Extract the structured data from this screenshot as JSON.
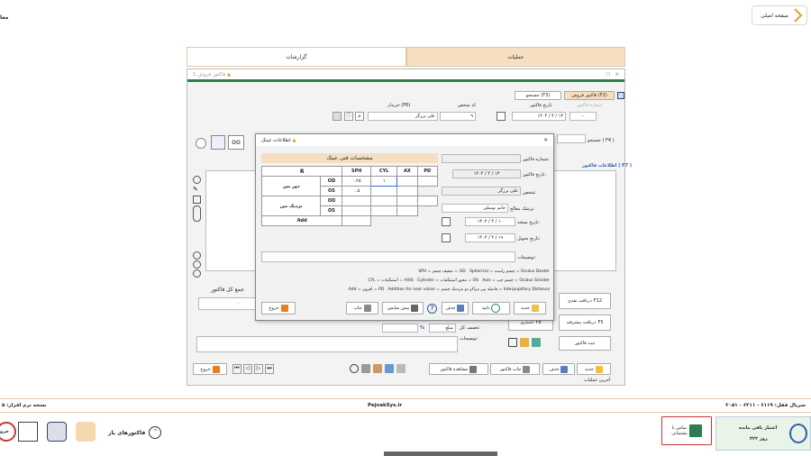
{
  "corner_text": "معا",
  "home_label": "صفحه اصلی",
  "tabs": {
    "reports": "گزارشات",
    "operations": "عملیات"
  },
  "window": {
    "title": "فاکتور فروش 1"
  },
  "subtabs": {
    "search": "جستجو (F3)",
    "factor": "فاکتور فروش (F2)"
  },
  "header": {
    "factor_no_lbl": "شماره فاکتور",
    "factor_date_lbl": "تاریخ فاکتور",
    "customer_code_lbl": "کد شخص",
    "buyer_lbl": "خریدار (F6)",
    "factor_no": "-",
    "factor_date": "۱۴۰۴ / ۴ / ۱۳",
    "customer_code": "۹",
    "buyer": "علی برزگر",
    "search_lbl": "جستجو ( F4 )",
    "info_lbl": "اطلاعات فاکتور ( F7 )",
    "hash": "#"
  },
  "dialog": {
    "title": "اطلاعات عینک",
    "section": "مشخصات فنی عینک",
    "cols": [
      "R",
      "SPH",
      "CYL",
      "AX",
      "PD"
    ],
    "od": "OD",
    "os": "OS",
    "far": "دور بین",
    "near": "نزدیک بین",
    "add": "Add",
    "od_sph": "۰.۲۵",
    "od_cyl": "۱",
    "os_sph": "۰.۵",
    "factor_no_lbl": "شماره فاکتور:",
    "factor_date_lbl": "تاریخ فاکتور:",
    "factor_date": "۱۴۰۴ / ۴ / ۱۳",
    "person_lbl": "شخص:",
    "person": "علی برزگر",
    "doctor_lbl": "پزشک معالج:",
    "doctor": "خانم توسلی",
    "rx_date_lbl": "تاریخ نسخه:",
    "rx_date": "۱۴۰۴ / ۴ / ۱۰",
    "deliver_lbl": "تاریخ تحویل:",
    "deliver_date": "۱۴۰۴ / ۴ / ۱۹",
    "desc_lbl": "توضیحات:",
    "legend": [
      "Spherical = ضعیف چشم = SPH",
      "Oculus Dexter = چشم راست = OD",
      "Cylinder = آستیگمات = CYL",
      "Axis = محور آستیگمات = AXIS",
      "Oculus Sinister = چشم چپ = OS",
      "Addition for near vision = افزون = Add",
      "Interpupillary Distance = فاصله بین مراکز دو مردمک چشم = PD"
    ],
    "btn_new": "جدید",
    "btn_confirm": "تایید",
    "btn_delete": "حذف",
    "btn_preview": "پیش نمایش",
    "btn_print": "چاپ",
    "btn_exit": "خروج"
  },
  "left": {
    "total_lbl": "جمع کل فاکتور",
    "total": "۰",
    "discount_lbl": "تخفیف کل:",
    "discount_type": "مبلغ",
    "percent": "%",
    "desc_lbl": "توضیحات:",
    "cash": "دریافت نقدی",
    "cash_key": "F12",
    "credit": "اعتباری",
    "credit_key": "F8",
    "prepay": "دریافت پیشرفته",
    "prepay_key": "F5",
    "register": "ثبت فاکتور"
  },
  "bottom": {
    "new": "جدید",
    "delete": "حذف",
    "print_factor": "چاپ فاکتور",
    "view_factor": "مشاهده فاکتور",
    "exit": "خروج",
    "last_ops": "آخرین عملیات"
  },
  "status": {
    "serial": "سریال قفل: ۶۱۱۹ - ۶۲۱۱ - ۲۰۵۱",
    "site": "PejvakSys.ir",
    "version": "نسخه نرم افزار: ۵"
  },
  "footer": {
    "credit_label": "اعتبار باقی مانده",
    "credit_days": "۳۲۲ روز",
    "contact": "تماس با",
    "support": "پشتیبانی",
    "open_factors": "فاکتورهای باز",
    "exit": "خرو"
  }
}
